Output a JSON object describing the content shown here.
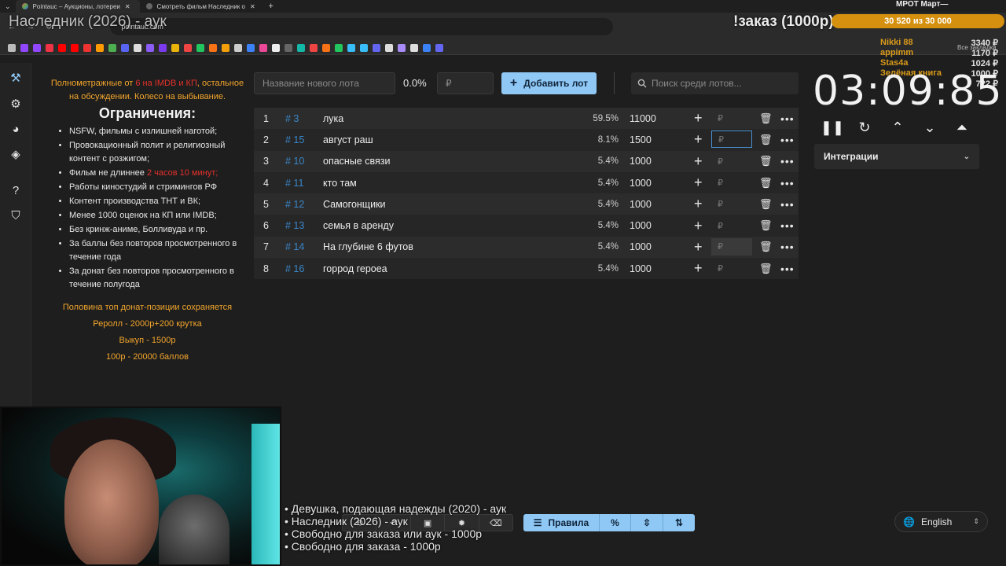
{
  "browser": {
    "tabs": [
      {
        "label": "Pointauc – Аукционы, лотереи"
      },
      {
        "label": "Смотреть фильм Наследник о"
      }
    ],
    "url": "pointauc.com",
    "bookmarks_label": "Все закладки"
  },
  "overlay": {
    "now_playing": "Наследник (2026) - аук",
    "order": "!заказ (1000р)",
    "mrot": "МРОТ Март—",
    "goal": "30 520  из 30 000",
    "donors": [
      {
        "name": "Nikki 88",
        "value": "3340 ₽"
      },
      {
        "name": "appimm",
        "value": "1170 ₽"
      },
      {
        "name": "Stas4a",
        "value": "1024 ₽"
      },
      {
        "name": "Зелёная книга",
        "value": "1000 ₽"
      },
      {
        "name": "",
        "value": "722 ₽"
      }
    ],
    "queue": [
      "• Девушка, подающая надежды (2020) - аук",
      "• Наследник (2026) - аук",
      "• Свободно для заказа или аук - 1000р",
      "• Свободно для заказа - 1000р"
    ]
  },
  "rules": {
    "intro_a": "Полнометражные от ",
    "intro_b": "6 на IMDB и КП",
    "intro_c": ", остальное на обсуждении. Колесо на выбывание.",
    "heading": "Ограничения:",
    "items": [
      "NSFW, фильмы с излишней наготой;",
      "Провокационный полит и религиозный контент с розжигом;",
      "Фильм не длиннее ",
      "Работы киностудий и стримингов РФ",
      "Контент производства ТНТ и ВК;",
      "Менее 1000 оценок на КП или IMDB;",
      "Без кринж-аниме, Болливуда и пр.",
      "За баллы без повторов просмотренного в течение года",
      "За донат без повторов просмотренного в течение полугода"
    ],
    "length_limit": "2 часов 10 минут;",
    "footer": [
      "Половина топ донат-позиции сохраняется",
      "Реролл - 2000р+200 крутка",
      "Выкуп - 1500р",
      "100р - 20000 баллов"
    ]
  },
  "lot_form": {
    "name_placeholder": "Название нового лота",
    "percent": "0.0%",
    "amount_placeholder": "₽",
    "add_label": "Добавить лот",
    "search_placeholder": "Поиск среди лотов..."
  },
  "lots": [
    {
      "idx": "1",
      "id": "# 3",
      "name": "лука",
      "pct": "59.5%",
      "amount": "11000"
    },
    {
      "idx": "2",
      "id": "# 15",
      "name": "август раш",
      "pct": "8.1%",
      "amount": "1500"
    },
    {
      "idx": "3",
      "id": "# 10",
      "name": "опасные связи",
      "pct": "5.4%",
      "amount": "1000"
    },
    {
      "idx": "4",
      "id": "# 11",
      "name": "кто там",
      "pct": "5.4%",
      "amount": "1000"
    },
    {
      "idx": "5",
      "id": "# 12",
      "name": "Самогонщики",
      "pct": "5.4%",
      "amount": "1000"
    },
    {
      "idx": "6",
      "id": "# 13",
      "name": "семья в аренду",
      "pct": "5.4%",
      "amount": "1000"
    },
    {
      "idx": "7",
      "id": "# 14",
      "name": "На глубине 6 футов",
      "pct": "5.4%",
      "amount": "1000"
    },
    {
      "idx": "8",
      "id": "# 16",
      "name": "горрод героеа",
      "pct": "5.4%",
      "amount": "1000"
    }
  ],
  "currency_symbol": "₽",
  "timer": {
    "value": "03:09:85"
  },
  "integrations": {
    "label": "Интеграции"
  },
  "bottom": {
    "rules_label": "Правила",
    "percent_symbol": "%"
  },
  "language": {
    "selected": "English"
  },
  "colors": {
    "accent": "#90c8f5",
    "orange": "#f2a52c",
    "red": "#e5312b",
    "id_blue": "#3a86c8"
  }
}
